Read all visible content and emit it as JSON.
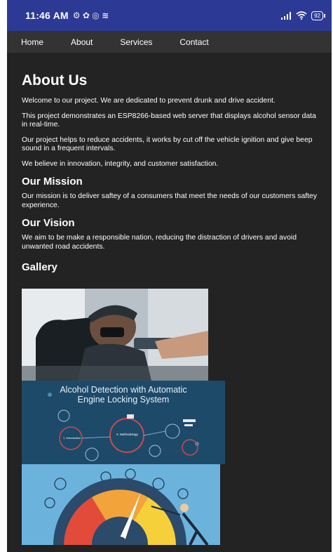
{
  "status": {
    "time": "11:46 AM",
    "notifications": "⚙ ✿ ◎ ≋",
    "battery": "92"
  },
  "nav": {
    "items": [
      {
        "label": "Home"
      },
      {
        "label": "About"
      },
      {
        "label": "Services"
      },
      {
        "label": "Contact"
      }
    ]
  },
  "main": {
    "title": "About Us",
    "intro_paragraphs": [
      "Welcome to our project. We are dedicated to prevent drunk and drive accident.",
      "This project demonstrates an ESP8266-based web server that displays alcohol sensor data in real-time.",
      "Our project helps to reduce accidents, it works by cut off the vehicle ignition and give beep sound in a frequent intervals.",
      "We believe in innovation, integrity, and customer satisfaction."
    ],
    "mission_heading": "Our Mission",
    "mission_text": "Our mission is to deliver saftey of a consumers that meet the needs of our customers saftey experience.",
    "vision_heading": "Our Vision",
    "vision_text": "We aim to be make a responsible nation, reducing the distraction of drivers and avoid unwanted road accidents.",
    "gallery_heading": "Gallery",
    "gallery": [
      {
        "image": "breathalyzer-test-photo"
      },
      {
        "image": "presentation-slide",
        "title_line1": "Alcohol Detection with Automatic",
        "title_line2": "Engine Locking System",
        "center_label": "2. Methodology",
        "left_label": "1. Introduction"
      },
      {
        "image": "alcohol-gauge-illustration"
      }
    ]
  },
  "colors": {
    "statusbar": "#2c3a96",
    "navbar": "#333333",
    "background": "#232323",
    "text": "#ffffff"
  }
}
